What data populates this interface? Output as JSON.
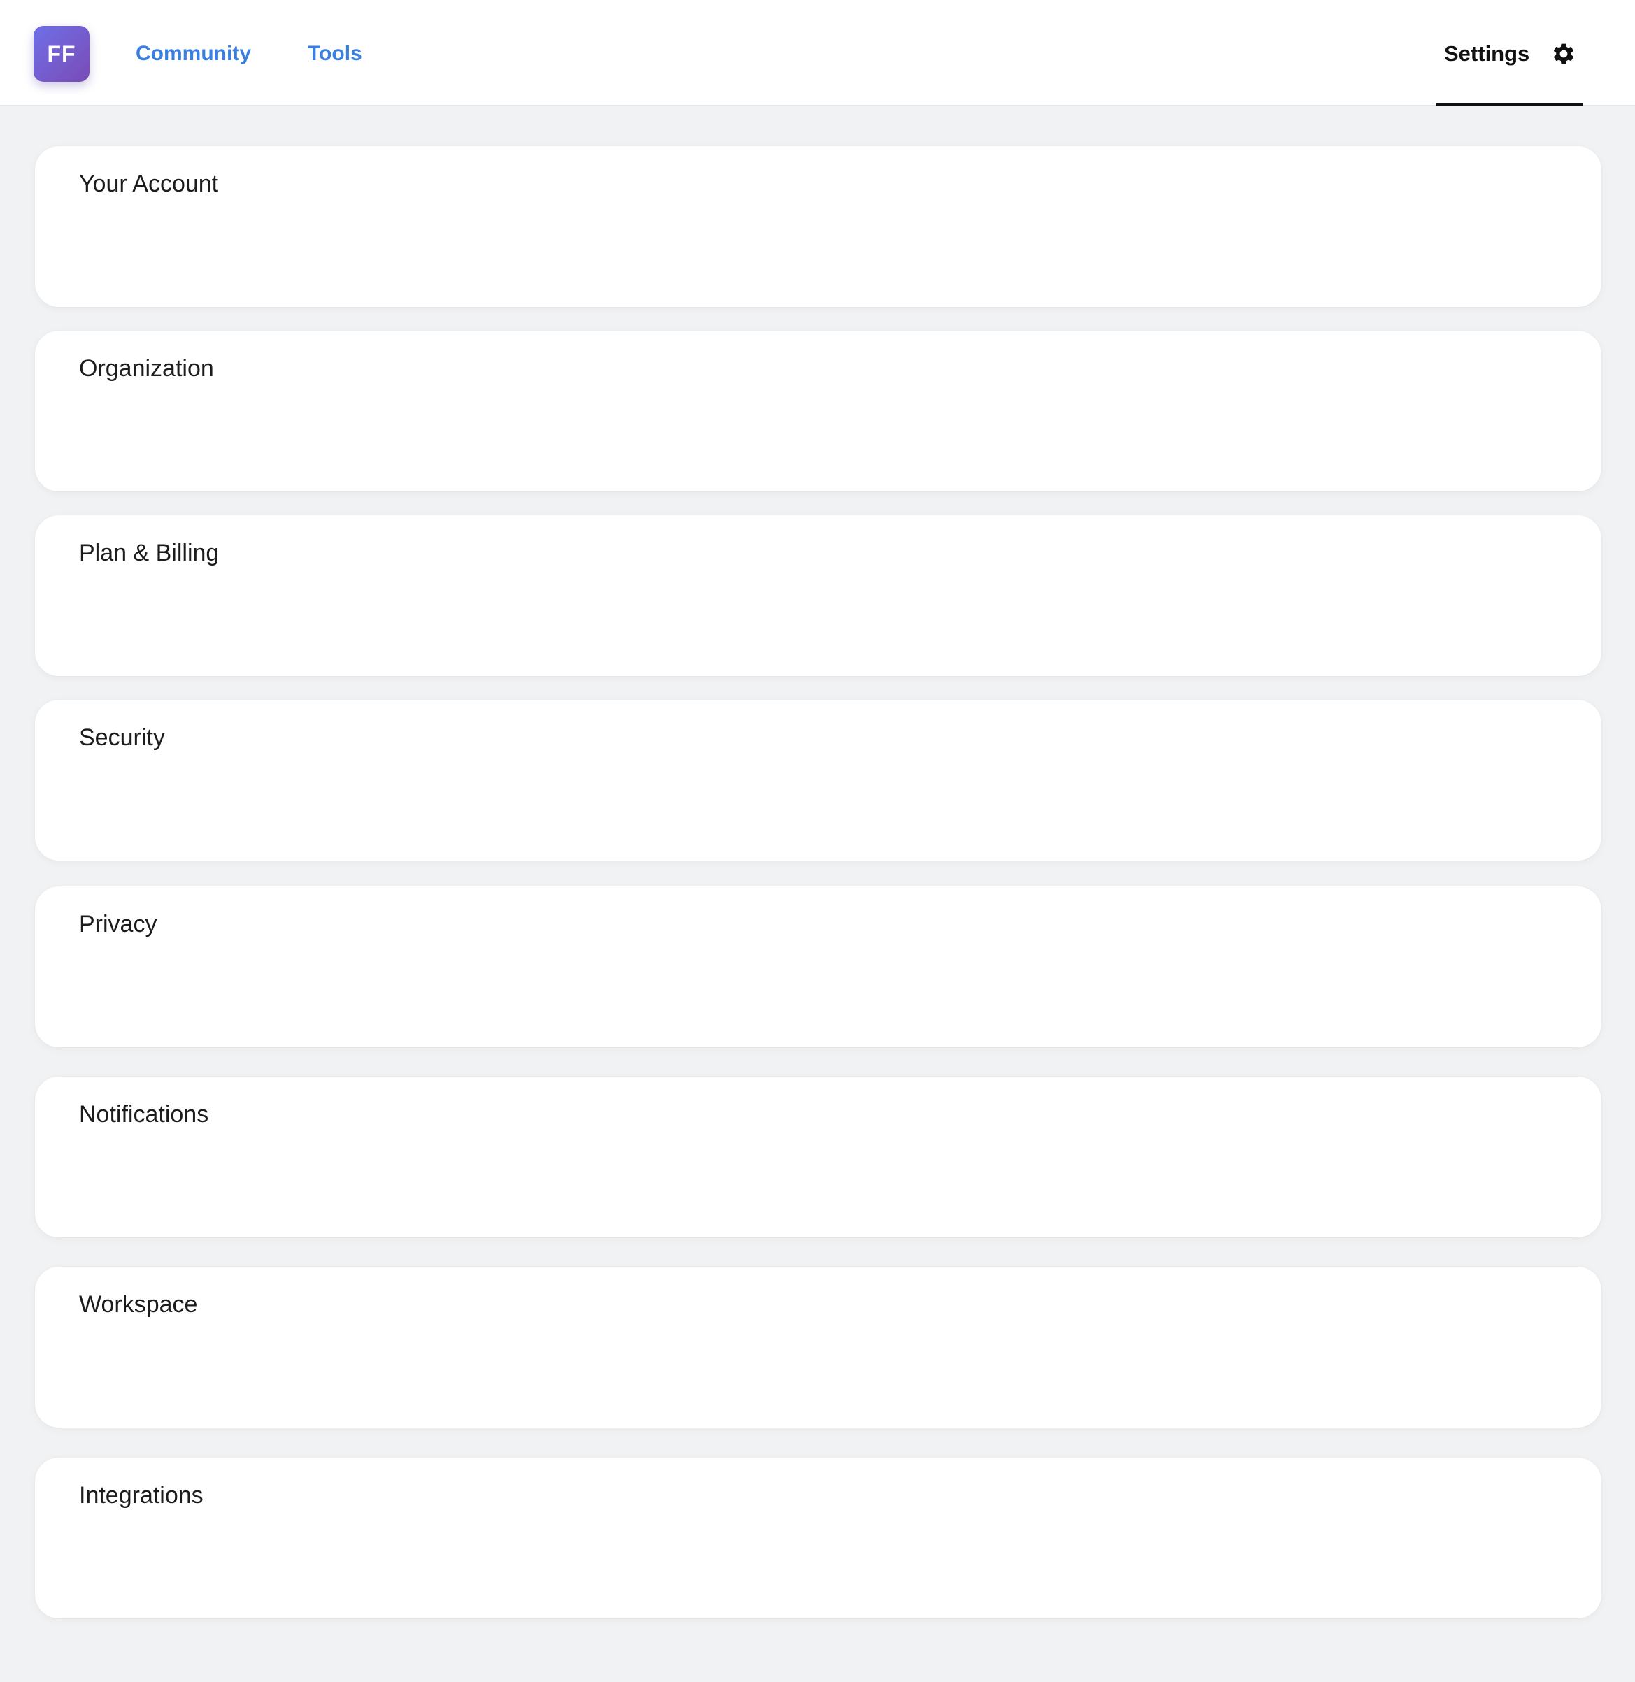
{
  "header": {
    "logo_text": "FF",
    "nav": [
      {
        "label": "Community"
      },
      {
        "label": "Tools"
      }
    ],
    "settings_label": "Settings",
    "settings_icon": "gear-icon",
    "accent_color": "#3a7fe0"
  },
  "sections": [
    {
      "title": "Your Account"
    },
    {
      "title": "Organization"
    },
    {
      "title": "Plan & Billing"
    },
    {
      "title": "Security"
    },
    {
      "title": "Privacy"
    },
    {
      "title": "Notifications"
    },
    {
      "title": "Workspace"
    },
    {
      "title": "Integrations"
    }
  ]
}
